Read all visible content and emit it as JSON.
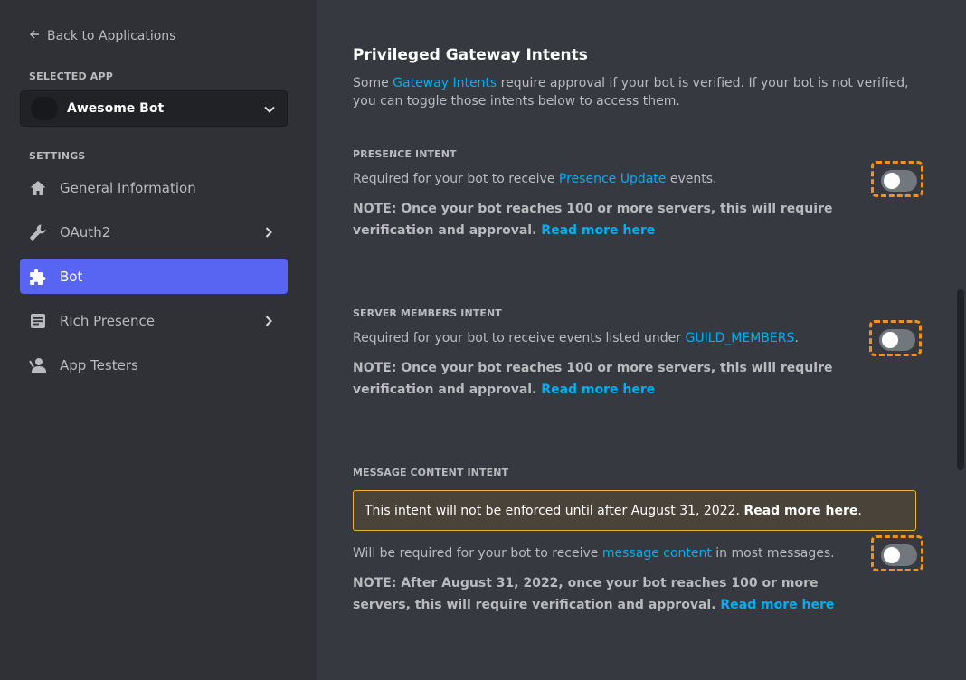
{
  "sidebar": {
    "back_label": "Back to Applications",
    "selected_app_heading": "SELECTED APP",
    "app_name": "Awesome Bot",
    "settings_heading": "SETTINGS",
    "items": [
      {
        "label": "General Information",
        "icon": "home-icon"
      },
      {
        "label": "OAuth2",
        "icon": "wrench-icon"
      },
      {
        "label": "Bot",
        "icon": "puzzle-icon"
      },
      {
        "label": "Rich Presence",
        "icon": "document-icon"
      },
      {
        "label": "App Testers",
        "icon": "user-icon"
      }
    ]
  },
  "main": {
    "title": "Privileged Gateway Intents",
    "intro_prefix": "Some ",
    "intro_link": "Gateway Intents",
    "intro_suffix": " require approval if your bot is verified. If your bot is not verified, you can toggle those intents below to access them.",
    "presence": {
      "heading": "PRESENCE INTENT",
      "desc_prefix": "Required for your bot to receive ",
      "desc_link": "Presence Update",
      "desc_suffix": " events.",
      "note": "NOTE: Once your bot reaches 100 or more servers, this will require verification and approval.",
      "note_link": "Read more here",
      "enabled": false
    },
    "members": {
      "heading": "SERVER MEMBERS INTENT",
      "desc_prefix": "Required for your bot to receive events listed under ",
      "desc_link": "GUILD_MEMBERS",
      "desc_suffix": ".",
      "note": "NOTE: Once your bot reaches 100 or more servers, this will require verification and approval.",
      "note_link": "Read more here",
      "enabled": false
    },
    "message": {
      "heading": "MESSAGE CONTENT INTENT",
      "warning_text": "This intent will not be enforced until after August 31, 2022.",
      "warning_link": "Read more here",
      "warning_suffix": ".",
      "desc_prefix": "Will be required for your bot to receive ",
      "desc_link": "message content",
      "desc_suffix": " in most messages.",
      "note": "NOTE: After August 31, 2022, once your bot reaches 100 or more servers, this will require verification and approval.",
      "note_link": "Read more here",
      "enabled": false
    }
  },
  "colors": {
    "accent": "#5865f2",
    "link": "#00aff4",
    "highlight": "#f0921e",
    "warning_border": "#f0b232"
  }
}
